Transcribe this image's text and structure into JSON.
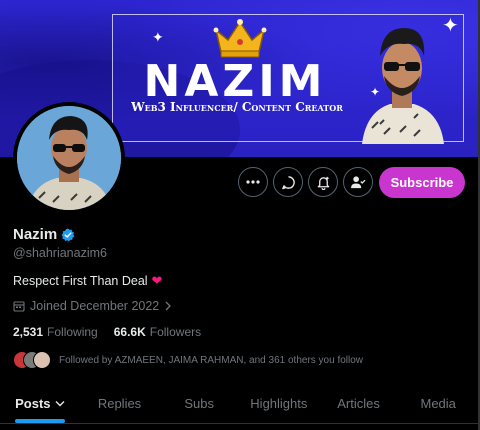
{
  "banner": {
    "title": "NAZIM",
    "subtitle": "Web3 Influencer/ Content Creator"
  },
  "profile": {
    "display_name": "Nazim",
    "handle": "@shahrianazim6",
    "bio": "Respect First Than Deal",
    "joined": "Joined December 2022",
    "following_count": "2,531",
    "following_label": "Following",
    "followers_count": "66.6K",
    "followers_label": "Followers",
    "followed_by": "Followed by AZMAEEN, JAIMA RAHMAN, and 361 others you follow"
  },
  "actions": {
    "more_icon": "more-icon",
    "message_icon": "message-icon",
    "notify_icon": "bell-plus-icon",
    "follow_icon": "person-check-icon",
    "subscribe_label": "Subscribe"
  },
  "tabs": [
    {
      "label": "Posts",
      "active": true
    },
    {
      "label": "Replies",
      "active": false
    },
    {
      "label": "Subs",
      "active": false
    },
    {
      "label": "Highlights",
      "active": false
    },
    {
      "label": "Articles",
      "active": false
    },
    {
      "label": "Media",
      "active": false
    }
  ],
  "colors": {
    "accent": "#1d9bf0",
    "subscribe": "#c936cf",
    "banner": "#2b23c7",
    "heart": "#f91880",
    "verified": "#1d9bf0"
  }
}
